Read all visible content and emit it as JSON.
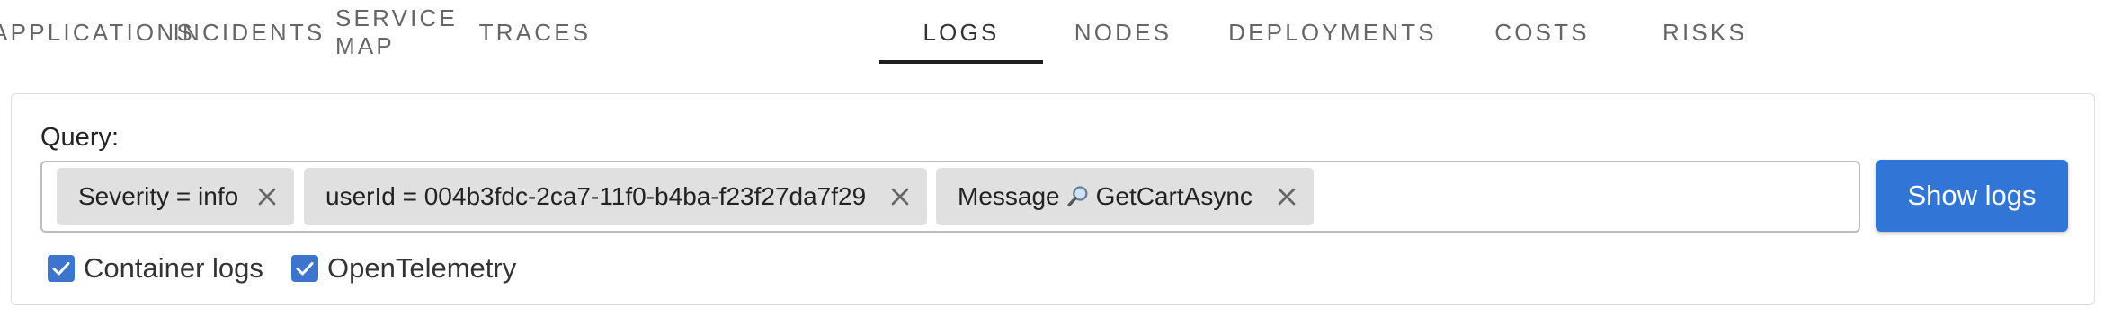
{
  "nav": {
    "tabs": [
      {
        "label": "APPLICATIONS"
      },
      {
        "label": "INCIDENTS"
      },
      {
        "label": "SERVICE MAP"
      },
      {
        "label": "TRACES"
      },
      {
        "label": "LOGS",
        "active": true
      },
      {
        "label": "NODES"
      },
      {
        "label": "DEPLOYMENTS"
      },
      {
        "label": "COSTS"
      },
      {
        "label": "RISKS"
      }
    ]
  },
  "query": {
    "label": "Query:",
    "chips": [
      {
        "text": "Severity = info"
      },
      {
        "text": "userId = 004b3fdc-2ca7-11f0-b4ba-f23f27da7f29"
      },
      {
        "prefix": "Message",
        "icon": "magnifier-icon",
        "text": "GetCartAsync"
      }
    ],
    "show_logs_label": "Show logs"
  },
  "sources": {
    "container_logs": {
      "label": "Container logs",
      "checked": true
    },
    "opentelemetry": {
      "label": "OpenTelemetry",
      "checked": true
    }
  },
  "colors": {
    "accent": "#3176d6",
    "checkbox": "#3d74cc",
    "chip_bg": "#e0e0e0",
    "tab_indicator": "#1f1f1f"
  }
}
